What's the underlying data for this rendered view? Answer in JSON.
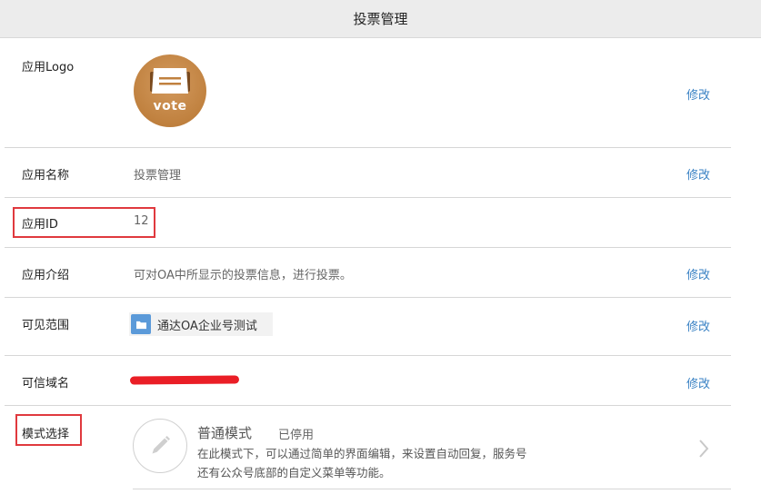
{
  "header": {
    "title": "投票管理"
  },
  "rows": {
    "logo": {
      "label": "应用Logo",
      "logo_text": "vote",
      "edit": "修改"
    },
    "name": {
      "label": "应用名称",
      "value": "投票管理",
      "edit": "修改"
    },
    "id": {
      "label": "应用ID",
      "value": "12"
    },
    "intro": {
      "label": "应用介绍",
      "value": "可对OA中所显示的投票信息，进行投票。",
      "edit": "修改"
    },
    "scope": {
      "label": "可见范围",
      "value": "通达OA企业号测试",
      "edit": "修改"
    },
    "domain": {
      "label": "可信域名",
      "edit": "修改"
    },
    "mode": {
      "label": "模式选择",
      "name": "普通模式",
      "status": "已停用",
      "desc_line1": "在此模式下，可以通过简单的界面编辑，来设置自动回复，服务号",
      "desc_line2": "还有公众号底部的自定义菜单等功能。"
    }
  },
  "colors": {
    "accent_link": "#3a82c4",
    "highlight": "#e0393e",
    "logo": "#c0813f",
    "folder": "#5b9ad9",
    "redaction": "#ea1e26"
  }
}
